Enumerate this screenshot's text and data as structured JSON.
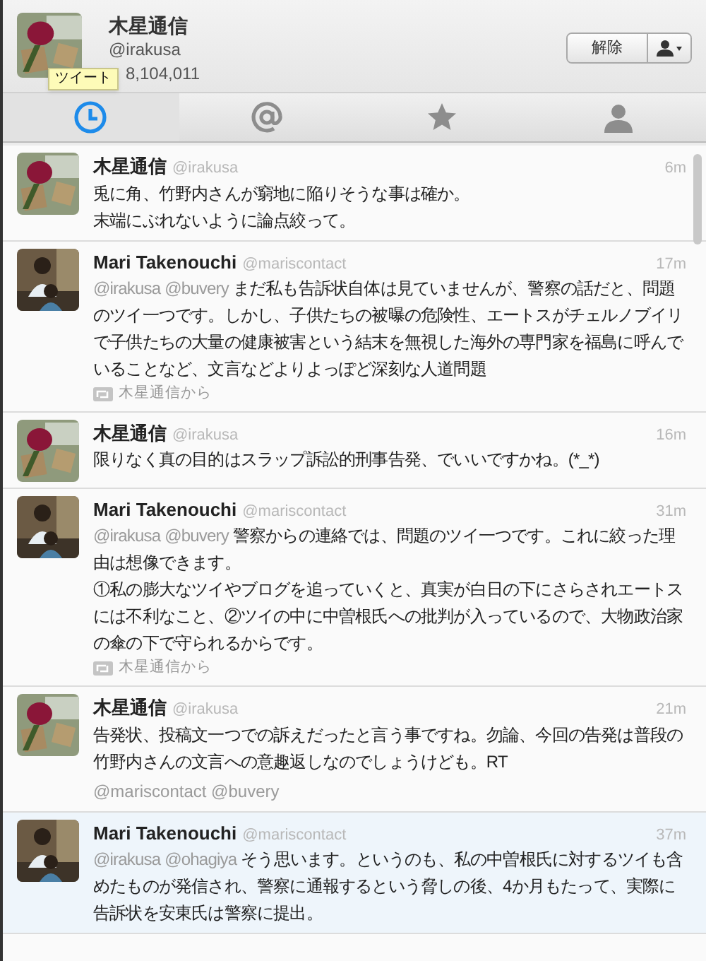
{
  "profile": {
    "name": "木星通信",
    "handle": "@irakusa",
    "count": "8,104,011",
    "tooltip": "ツイート",
    "unfollow_button": "解除"
  },
  "tabs": [
    {
      "kind": "timeline",
      "selected": true
    },
    {
      "kind": "mentions",
      "selected": false
    },
    {
      "kind": "favorites",
      "selected": false
    },
    {
      "kind": "profile",
      "selected": false
    }
  ],
  "tweets": [
    {
      "name": "木星通信",
      "handle": "@irakusa",
      "time": "6m",
      "selected": false,
      "paragraphs": [
        {
          "text": "兎に角、竹野内さんが窮地に陥りそうな事は確か。"
        },
        {
          "text": "末端にぶれないように論点絞って。"
        }
      ]
    },
    {
      "name": "Mari Takenouchi",
      "handle": "@mariscontact",
      "time": "17m",
      "selected": false,
      "paragraphs": [
        {
          "mentions": "@irakusa @buvery",
          "text": "まだ私も告訴状自体は見ていませんが、警察の話だと、問題のツイ一つです。しかし、子供たちの被曝の危険性、エートスがチェルノブイリで子供たちの大量の健康被害という結末を無視した海外の専門家を福島に呼んでいることなど、文言などよりよっぽど深刻な人道問題"
        }
      ],
      "retweeted_by": "木星通信から"
    },
    {
      "name": "木星通信",
      "handle": "@irakusa",
      "time": "16m",
      "selected": false,
      "paragraphs": [
        {
          "text": "限りなく真の目的はスラップ訴訟的刑事告発、でいいですかね。(*_*)"
        }
      ]
    },
    {
      "name": "Mari Takenouchi",
      "handle": "@mariscontact",
      "time": "31m",
      "selected": false,
      "paragraphs": [
        {
          "mentions": "@irakusa @buvery",
          "text": "警察からの連絡では、問題のツイ一つです。これに絞った理由は想像できます。"
        },
        {
          "text": "①私の膨大なツイやブログを追っていくと、真実が白日の下にさらされエートスには不利なこと、②ツイの中に中曽根氏への批判が入っているので、大物政治家の傘の下で守られるからです。"
        }
      ],
      "retweeted_by": "木星通信から"
    },
    {
      "name": "木星通信",
      "handle": "@irakusa",
      "time": "21m",
      "selected": false,
      "paragraphs": [
        {
          "text": "告発状、投稿文一つでの訴えだったと言う事ですね。勿論、今回の告発は普段の竹野内さんの文言への意趣返しなのでしょうけども。RT"
        }
      ],
      "footer_mentions": "@mariscontact @buvery"
    },
    {
      "name": "Mari Takenouchi",
      "handle": "@mariscontact",
      "time": "37m",
      "selected": true,
      "paragraphs": [
        {
          "mentions": "@irakusa @ohagiya",
          "text": "そう思います。というのも、私の中曽根氏に対するツイも含めたものが発信され、警察に通報するという脅しの後、4か月もたって、実際に告訴状を安東氏は警察に提出。"
        }
      ]
    }
  ]
}
